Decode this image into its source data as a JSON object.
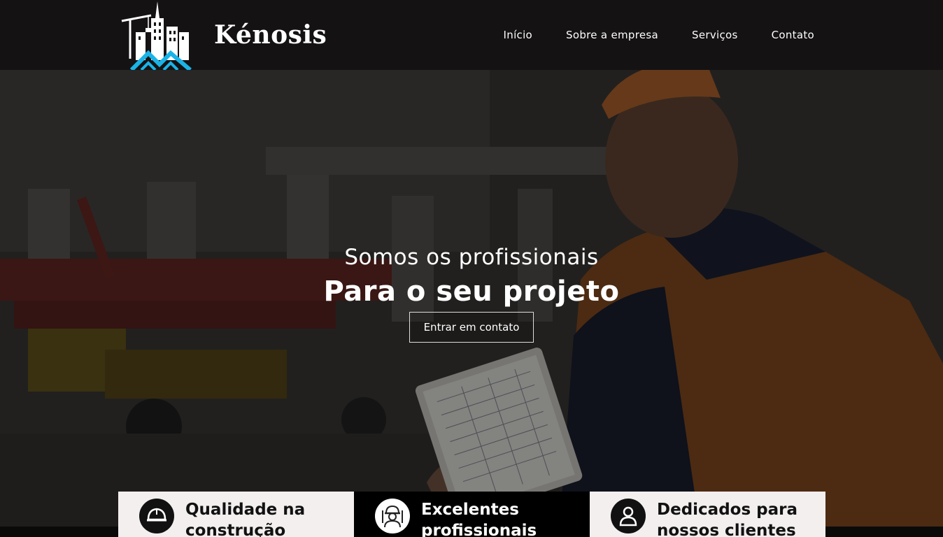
{
  "brand": {
    "name": "Kénosis",
    "logo_icon": "construction-skyline-logo"
  },
  "nav": {
    "items": [
      {
        "label": "Início"
      },
      {
        "label": "Sobre a empresa"
      },
      {
        "label": "Serviços"
      },
      {
        "label": "Contato"
      }
    ]
  },
  "hero": {
    "subtitle": "Somos os profissionais",
    "title": "Para o seu projeto",
    "cta_label": "Entrar em contato"
  },
  "features": [
    {
      "title": "Qualidade na construção",
      "icon": "hard-hat-icon"
    },
    {
      "title": "Excelentes profissionais",
      "icon": "worker-icon"
    },
    {
      "title": "Dedicados para nossos clientes",
      "icon": "user-icon"
    }
  ],
  "colors": {
    "header_bg": "#141213",
    "logo_accent": "#1ab3e8",
    "feature_light_bg": "#f4efef",
    "feature_dark_bg": "#000000",
    "vest_orange": "#e8731f"
  }
}
